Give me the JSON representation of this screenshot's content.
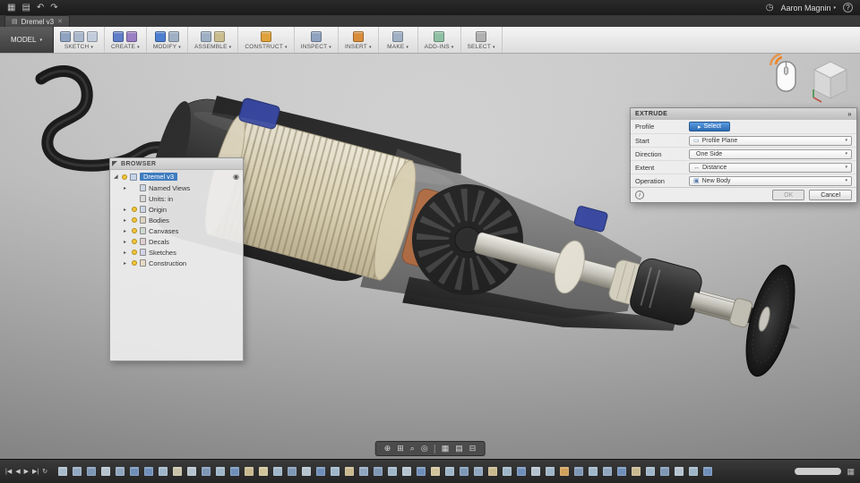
{
  "titlebar": {
    "icons": [
      {
        "g": "▦",
        "n": "apps-grid-icon"
      },
      {
        "g": "▤",
        "n": "data-panel-icon"
      },
      {
        "g": "↶",
        "n": "undo-icon"
      },
      {
        "g": "↷",
        "n": "redo-icon"
      }
    ],
    "clock": "◷",
    "user": "Aaron Magnin",
    "user_caret": "▾",
    "help": "?"
  },
  "tabbar": {
    "tab_icon": "▤",
    "tab_label": "Dremel v3",
    "close": "✕"
  },
  "toolbar": {
    "model_label": "MODEL",
    "caret": "▾",
    "groups": [
      {
        "label": "SKETCH",
        "c0": "#8fa3c0",
        "c1": "#aab8cc",
        "c2": "#c2cddb"
      },
      {
        "label": "CREATE",
        "c0": "#5f7ec9",
        "c1": "#9a7fc4"
      },
      {
        "label": "MODIFY",
        "c0": "#4d7fd1",
        "c1": "#9fb0c4"
      },
      {
        "label": "ASSEMBLE",
        "c0": "#9fb0c4",
        "c1": "#c9bd8e"
      },
      {
        "label": "CONSTRUCT",
        "c0": "#e0a23c"
      },
      {
        "label": "INSPECT",
        "c0": "#8fa3c0"
      },
      {
        "label": "INSERT",
        "c0": "#d98e3c"
      },
      {
        "label": "MAKE",
        "c0": "#9fb0c4"
      },
      {
        "label": "ADD-INS",
        "c0": "#8fc0a3"
      },
      {
        "label": "SELECT",
        "c0": "#b0b0b0"
      }
    ]
  },
  "browser": {
    "title": "BROWSER",
    "root": {
      "label": "Dremel v3",
      "exp": "◢",
      "radio": "◉"
    },
    "items": [
      {
        "label": "Named Views",
        "exp": true,
        "bulb": false,
        "ic": "#ccd6e6"
      },
      {
        "label": "Units: in",
        "exp": false,
        "bulb": false,
        "ic": "#d9d9d9"
      },
      {
        "label": "Origin",
        "exp": true,
        "bulb": true,
        "ic": "#ccd6e6"
      },
      {
        "label": "Bodies",
        "exp": true,
        "bulb": true,
        "ic": "#ddd3c2"
      },
      {
        "label": "Canvases",
        "exp": true,
        "bulb": true,
        "ic": "#cfd9cf"
      },
      {
        "label": "Decals",
        "exp": true,
        "bulb": true,
        "ic": "#e0d0d0"
      },
      {
        "label": "Sketches",
        "exp": true,
        "bulb": true,
        "ic": "#d3d3e6"
      },
      {
        "label": "Construction",
        "exp": true,
        "bulb": true,
        "ic": "#e6dac4"
      }
    ]
  },
  "extrude": {
    "title": "EXTRUDE",
    "collapse": "»",
    "profile_label": "Profile",
    "select_button": "Select",
    "select_icon": "▸",
    "rows": [
      {
        "label": "Start",
        "value": "Profile Plane",
        "icon": "▭"
      },
      {
        "label": "Direction",
        "value": "One Side",
        "icon": ""
      },
      {
        "label": "Extent",
        "value": "Distance",
        "icon": "↔"
      },
      {
        "label": "Operation",
        "value": "New Body",
        "icon": "▣"
      }
    ],
    "caret": "▾",
    "info": "i",
    "ok": "OK",
    "cancel": "Cancel"
  },
  "navbar": {
    "icons_left": [
      {
        "g": "⊕",
        "n": "fit-view-icon"
      },
      {
        "g": "⊞",
        "n": "pan-icon"
      },
      {
        "g": "⌕",
        "n": "zoom-icon"
      },
      {
        "g": "◎",
        "n": "orbit-icon"
      }
    ],
    "icons_right": [
      {
        "g": "▦",
        "n": "display-settings-icon"
      },
      {
        "g": "▤",
        "n": "grid-settings-icon"
      },
      {
        "g": "⊟",
        "n": "viewports-icon"
      }
    ]
  },
  "timeline": {
    "controls": [
      {
        "g": "|◀",
        "n": "skip-to-start-button"
      },
      {
        "g": "◀",
        "n": "step-back-button"
      },
      {
        "g": "▶",
        "n": "play-button"
      },
      {
        "g": "▶|",
        "n": "skip-to-end-button"
      },
      {
        "g": "↻",
        "n": "replay-button"
      }
    ],
    "end_icon": "▦",
    "items": [
      "#a9bccb",
      "#93a9c2",
      "#7d97b5",
      "#b5c3cf",
      "#8fa5c0",
      "#6f8fba",
      "#6f8fba",
      "#9fb6c9",
      "#c9c2a8",
      "#b5c3cf",
      "#7d97b5",
      "#9fb6c9",
      "#6f8fba",
      "#c9b98e",
      "#d1c49a",
      "#9fb6c9",
      "#7d97b5",
      "#b5c3cf",
      "#6f8fba",
      "#9fb6c9",
      "#c9b98e",
      "#8fa5c0",
      "#7d97b5",
      "#9fb6c9",
      "#b5c3cf",
      "#6f8fba",
      "#d1c49a",
      "#9fb6c9",
      "#7d97b5",
      "#8fa5c0",
      "#c9b98e",
      "#9fb6c9",
      "#6f8fba",
      "#b5c3cf",
      "#9fb6c9",
      "#d1a05a",
      "#7d97b5",
      "#9fb6c9",
      "#8fa5c0",
      "#6f8fba",
      "#c9b98e",
      "#9fb6c9",
      "#7d97b5",
      "#b5c3cf",
      "#9fb6c9",
      "#6f8fba"
    ]
  }
}
